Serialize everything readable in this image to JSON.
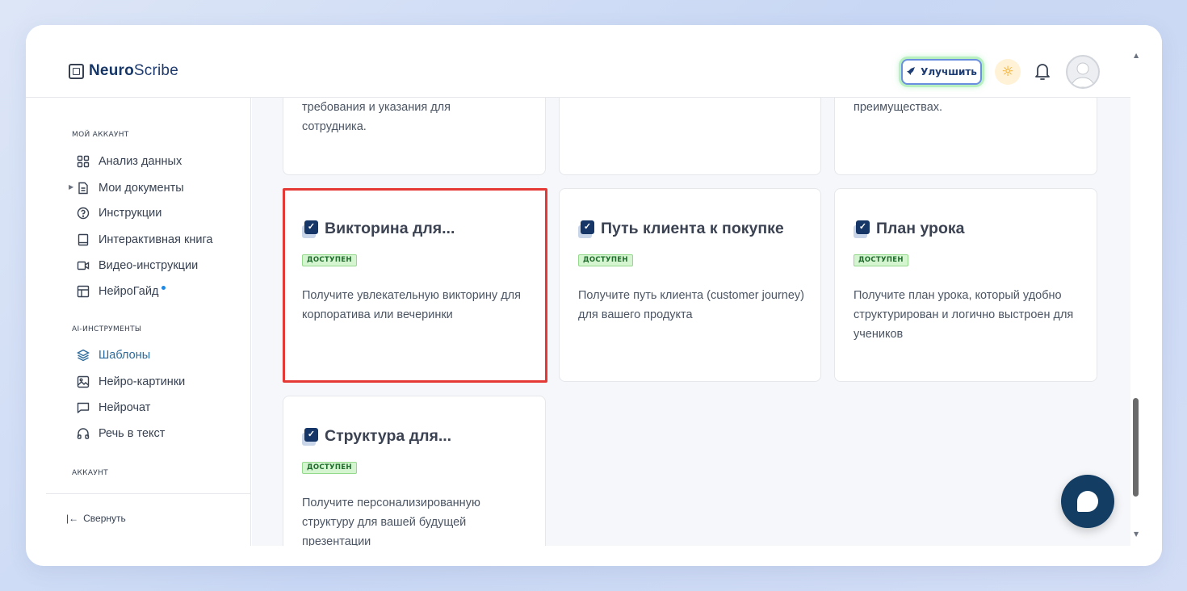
{
  "app": {
    "logo_bold": "Neuro",
    "logo_regular": "Scribe"
  },
  "header": {
    "upgrade_label": "Улучшить"
  },
  "sidebar": {
    "section_my_account": "МОЙ АККАУНТ",
    "items_account": [
      {
        "label": "Анализ данных",
        "icon": "grid-icon"
      },
      {
        "label": "Мои документы",
        "icon": "document-icon"
      },
      {
        "label": "Инструкции",
        "icon": "help-circle-icon"
      },
      {
        "label": "Интерактивная книга",
        "icon": "book-icon"
      },
      {
        "label": "Видео-инструкции",
        "icon": "video-icon"
      },
      {
        "label": "НейроГайд",
        "icon": "layout-icon"
      }
    ],
    "section_ai_tools": "AI-ИНСТРУМЕНТЫ",
    "items_ai": [
      {
        "label": "Шаблоны",
        "icon": "layers-icon",
        "active": true
      },
      {
        "label": "Нейро-картинки",
        "icon": "image-icon"
      },
      {
        "label": "Нейрочат",
        "icon": "chat-icon"
      },
      {
        "label": "Речь в текст",
        "icon": "headphones-icon"
      }
    ],
    "section_account": "АККАУНТ",
    "collapse_label": "Свернуть"
  },
  "cards_partial": {
    "col1_text_line1": "требования и указания для",
    "col1_text_line2": "сотрудника.",
    "col3_text_line1": "преимуществах."
  },
  "cards": [
    {
      "title": "Викторина для...",
      "badge": "ДОСТУПЕН",
      "description": "Получите увлекательную викторину для корпоратива или вечеринки",
      "highlighted": true
    },
    {
      "title": "Путь клиента к покупке",
      "badge": "ДОСТУПЕН",
      "description": "Получите путь клиента (customer journey) для вашего продукта"
    },
    {
      "title": "План урока",
      "badge": "ДОСТУПЕН",
      "description": "Получите план урока, который удобно структурирован и логично выстроен для учеников"
    },
    {
      "title": "Структура для...",
      "badge": "ДОСТУПЕН",
      "description": "Получите персонализированную структуру для вашей будущей презентации"
    }
  ],
  "colors": {
    "accent_navy": "#163668",
    "active_nav": "#2c6a9c",
    "badge_bg": "#d4f5d0",
    "highlight_border": "#e53935"
  }
}
